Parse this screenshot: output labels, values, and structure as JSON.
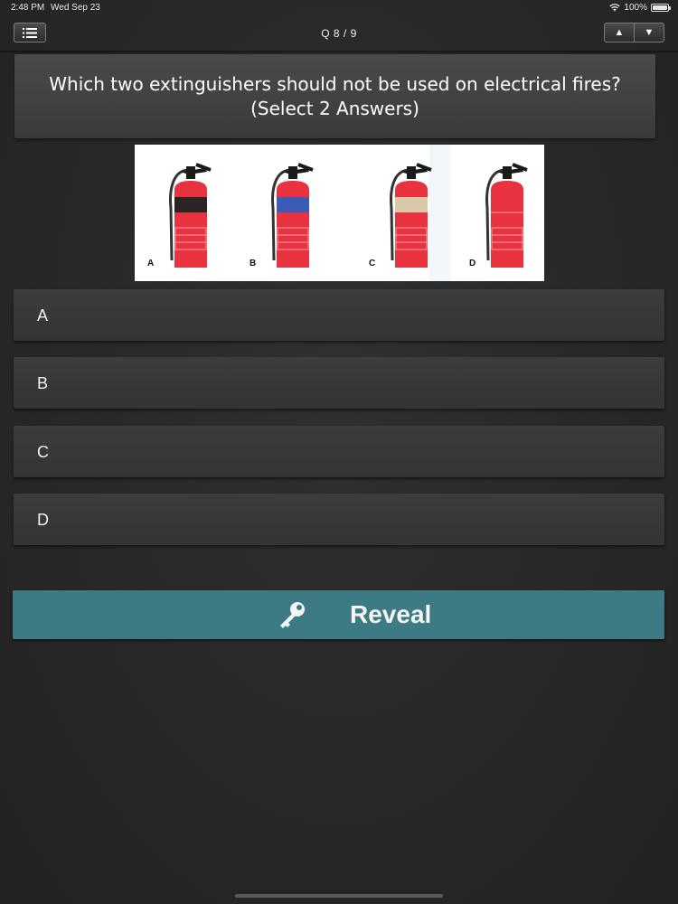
{
  "status_bar": {
    "time": "2:48 PM",
    "date": "Wed Sep 23",
    "battery": "100%"
  },
  "nav": {
    "counter": "Q 8 / 9",
    "up_arrow": "▲",
    "down_arrow": "▼"
  },
  "question": {
    "text": "Which two extinguishers should not be used on electrical fires? (Select 2 Answers)"
  },
  "image": {
    "extinguishers": [
      {
        "label": "A",
        "band_color": "#2a2424"
      },
      {
        "label": "B",
        "band_color": "#3b5bb5"
      },
      {
        "label": "C",
        "band_color": "#d9c9a8"
      },
      {
        "label": "D",
        "band_color": "#e8323f"
      }
    ],
    "body_color": "#e8323f"
  },
  "answers": [
    {
      "label": "A"
    },
    {
      "label": "B"
    },
    {
      "label": "C"
    },
    {
      "label": "D"
    }
  ],
  "reveal": {
    "label": "Reveal",
    "color": "#3d7b84",
    "icon": "key-icon"
  }
}
